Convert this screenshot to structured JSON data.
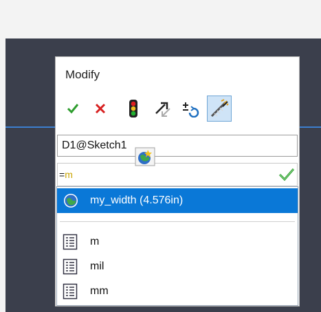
{
  "dialog": {
    "title": "Modify",
    "toolbar": {
      "ok": "check-icon",
      "cancel": "x-icon",
      "rebuild": "traffic-light-icon",
      "reverse": "arrow-reverse-icon",
      "spin": "spin-increment-icon",
      "mark": "mark-dimension-icon"
    },
    "name_value": "D1@Sketch1",
    "value_prefix": "=",
    "value_typed": "m"
  },
  "dropdown": {
    "items": [
      {
        "label": "my_width (4.576in)",
        "icon": "globe-icon",
        "selected": true
      },
      {
        "label": "m",
        "icon": "list-icon",
        "selected": false
      },
      {
        "label": "mil",
        "icon": "list-icon",
        "selected": false
      },
      {
        "label": "mm",
        "icon": "list-icon",
        "selected": false
      }
    ]
  },
  "colors": {
    "canvas": "#3b3f4c",
    "selection": "#0a78d7",
    "ok": "#2e9d2e",
    "cancel": "#d72020",
    "typed": "#c9a400"
  }
}
